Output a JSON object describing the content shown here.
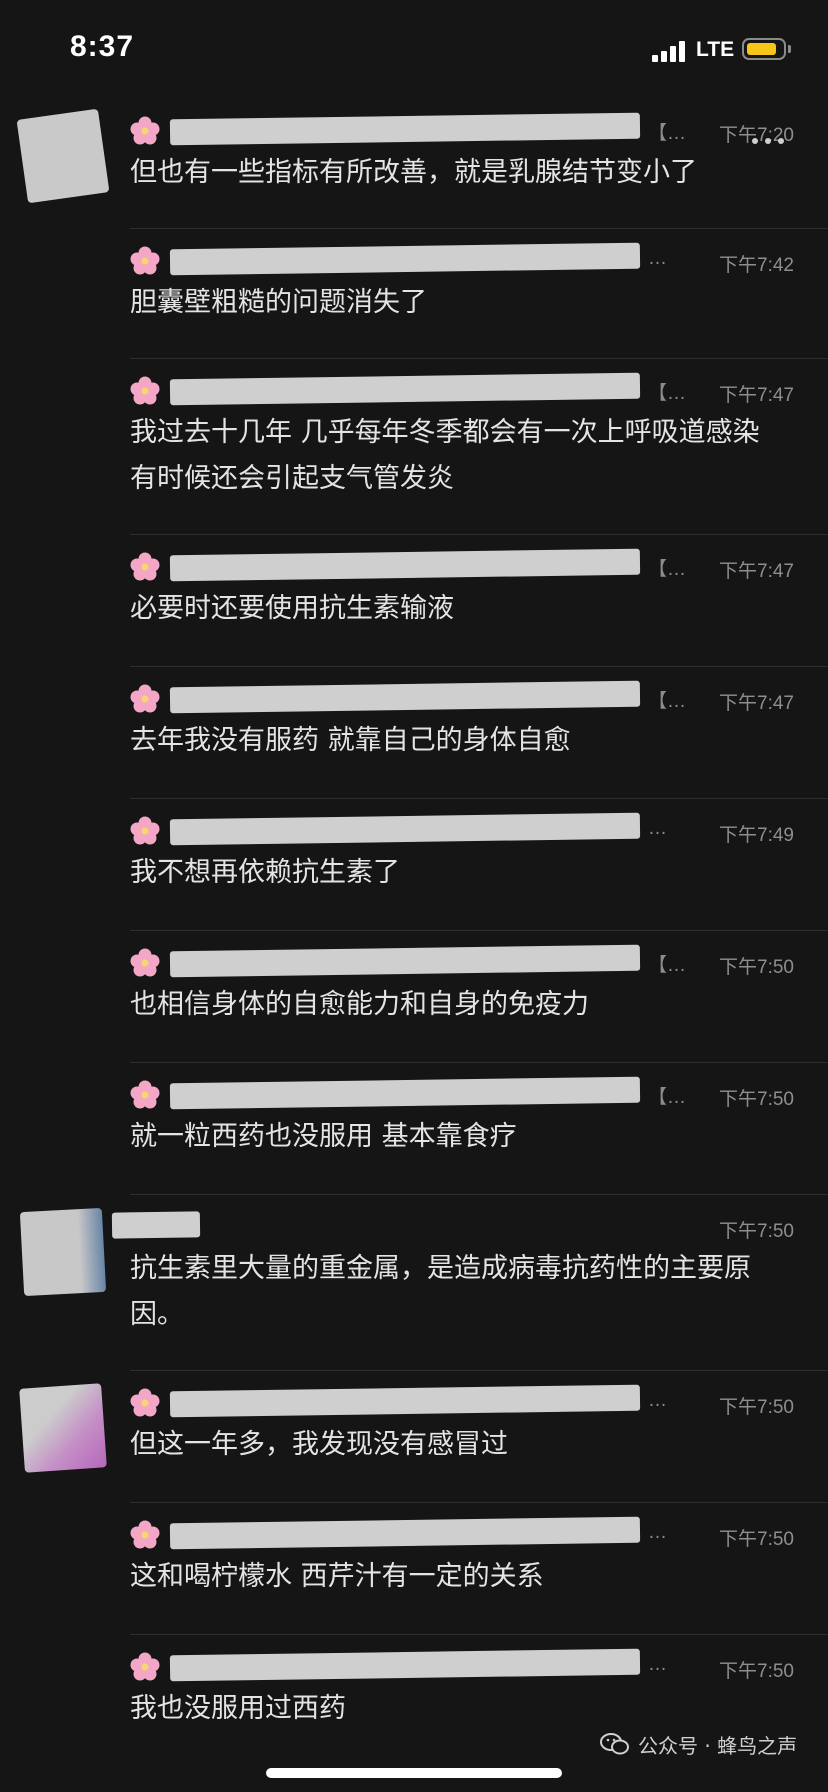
{
  "status_bar": {
    "time": "8:37",
    "network": "LTE",
    "battery_level": 0.8,
    "battery_color": "#f5c518"
  },
  "messages": [
    {
      "time": "下午7:20",
      "sender_suffix": "【…",
      "text": "但也有一些指标有所改善，就是乳腺结节变小了",
      "avatar": true
    },
    {
      "time": "下午7:42",
      "sender_suffix": "…",
      "text": "胆囊壁粗糙的问题消失了"
    },
    {
      "time": "下午7:47",
      "sender_suffix": "【…",
      "text": "我过去十几年 几乎每年冬季都会有一次上呼吸道感染 有时候还会引起支气管发炎"
    },
    {
      "time": "下午7:47",
      "sender_suffix": "【…",
      "text": "必要时还要使用抗生素输液"
    },
    {
      "time": "下午7:47",
      "sender_suffix": "【…",
      "text": "去年我没有服药 就靠自己的身体自愈"
    },
    {
      "time": "下午7:49",
      "sender_suffix": "…",
      "text": "我不想再依赖抗生素了"
    },
    {
      "time": "下午7:50",
      "sender_suffix": "【…",
      "text": "也相信身体的自愈能力和自身的免疫力"
    },
    {
      "time": "下午7:50",
      "sender_suffix": "【…",
      "text": "就一粒西药也没服用 基本靠食疗"
    },
    {
      "time": "下午7:50",
      "sender_suffix": "",
      "text": "抗生素里大量的重金属，是造成病毒抗药性的主要原因。",
      "avatar": true
    },
    {
      "time": "下午7:50",
      "sender_suffix": "…",
      "text": "但这一年多，我发现没有感冒过",
      "avatar": true
    },
    {
      "time": "下午7:50",
      "sender_suffix": "…",
      "text": "这和喝柠檬水 西芹汁有一定的关系"
    },
    {
      "time": "下午7:50",
      "sender_suffix": "…",
      "text": "我也没服用过西药"
    }
  ],
  "watermark": {
    "text": "公众号 · 蜂鸟之声",
    "logo_icon": "wechat-icon"
  },
  "icons": {
    "flower": "cherry-blossom-icon",
    "menu": "more-options-icon"
  }
}
